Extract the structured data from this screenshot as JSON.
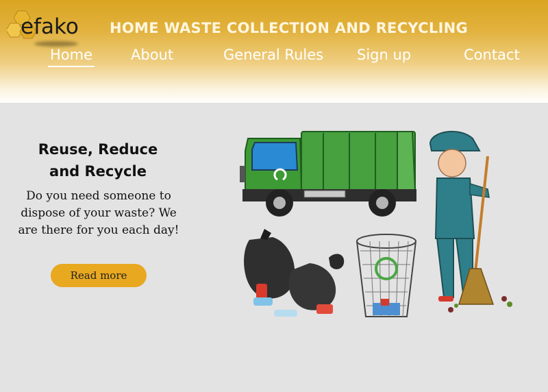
{
  "header": {
    "logo": {
      "text": "efako"
    },
    "title": "HOME WASTE COLLECTION AND RECYCLING",
    "nav": [
      {
        "label": "Home",
        "active": true
      },
      {
        "label": "About",
        "active": false
      },
      {
        "label": "General Rules",
        "active": false
      },
      {
        "label": "Sign up",
        "active": false
      },
      {
        "label": "Contact",
        "active": false
      }
    ]
  },
  "hero": {
    "heading_line1": "Reuse, Reduce",
    "heading_line2": "and Recycle",
    "text": "Do you need someone to dispose of your waste? We are there for you each day!",
    "button_label": "Read more",
    "illustration_icons": [
      "garbage-truck-icon",
      "recycle-icon",
      "garbage-bag-icon",
      "recycling-bin-icon",
      "street-sweeper-icon",
      "broom-icon"
    ]
  },
  "colors": {
    "header_gold": "#d9a521",
    "button": "#e8a820",
    "page_background": "#e3e3e3",
    "truck_green": "#3f9a3c",
    "worker_teal": "#2f7f8a"
  }
}
